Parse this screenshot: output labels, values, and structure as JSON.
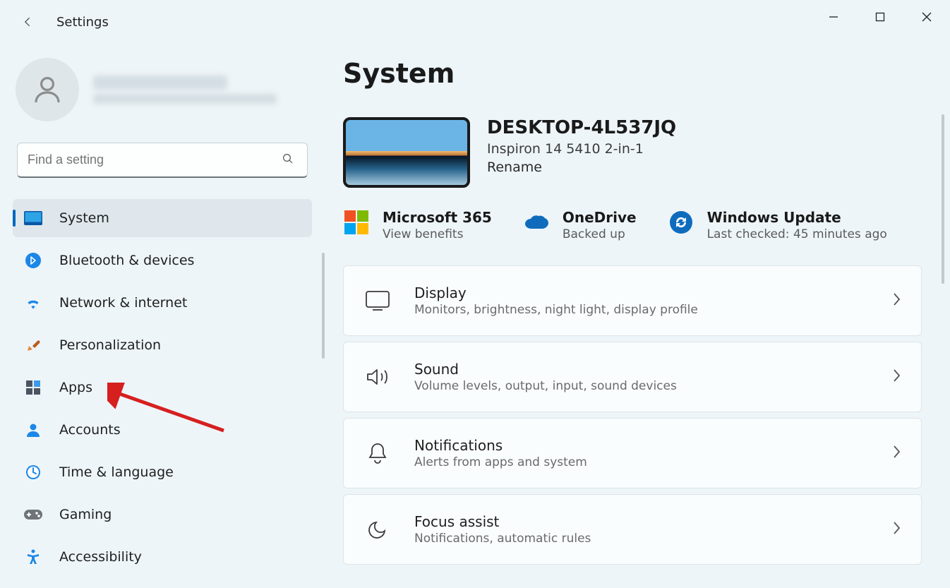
{
  "window": {
    "title": "Settings"
  },
  "search": {
    "placeholder": "Find a setting"
  },
  "sidebar": {
    "items": [
      {
        "label": "System",
        "icon": "system-icon"
      },
      {
        "label": "Bluetooth & devices",
        "icon": "bluetooth-icon"
      },
      {
        "label": "Network & internet",
        "icon": "wifi-icon"
      },
      {
        "label": "Personalization",
        "icon": "personalization-icon"
      },
      {
        "label": "Apps",
        "icon": "apps-icon"
      },
      {
        "label": "Accounts",
        "icon": "accounts-icon"
      },
      {
        "label": "Time & language",
        "icon": "time-language-icon"
      },
      {
        "label": "Gaming",
        "icon": "gaming-icon"
      },
      {
        "label": "Accessibility",
        "icon": "accessibility-icon"
      }
    ],
    "active_index": 0,
    "annotated_index": 4
  },
  "main": {
    "heading": "System",
    "device": {
      "name": "DESKTOP-4L537JQ",
      "model": "Inspiron 14 5410 2-in-1",
      "rename_label": "Rename"
    },
    "status": [
      {
        "title": "Microsoft 365",
        "subtitle": "View benefits",
        "icon": "microsoft-logo-icon"
      },
      {
        "title": "OneDrive",
        "subtitle": "Backed up",
        "icon": "onedrive-icon"
      },
      {
        "title": "Windows Update",
        "subtitle": "Last checked: 45 minutes ago",
        "icon": "windows-update-icon"
      }
    ],
    "settings": [
      {
        "title": "Display",
        "subtitle": "Monitors, brightness, night light, display profile",
        "icon": "display-icon"
      },
      {
        "title": "Sound",
        "subtitle": "Volume levels, output, input, sound devices",
        "icon": "sound-icon"
      },
      {
        "title": "Notifications",
        "subtitle": "Alerts from apps and system",
        "icon": "notifications-icon"
      },
      {
        "title": "Focus assist",
        "subtitle": "Notifications, automatic rules",
        "icon": "focus-assist-icon"
      }
    ]
  }
}
